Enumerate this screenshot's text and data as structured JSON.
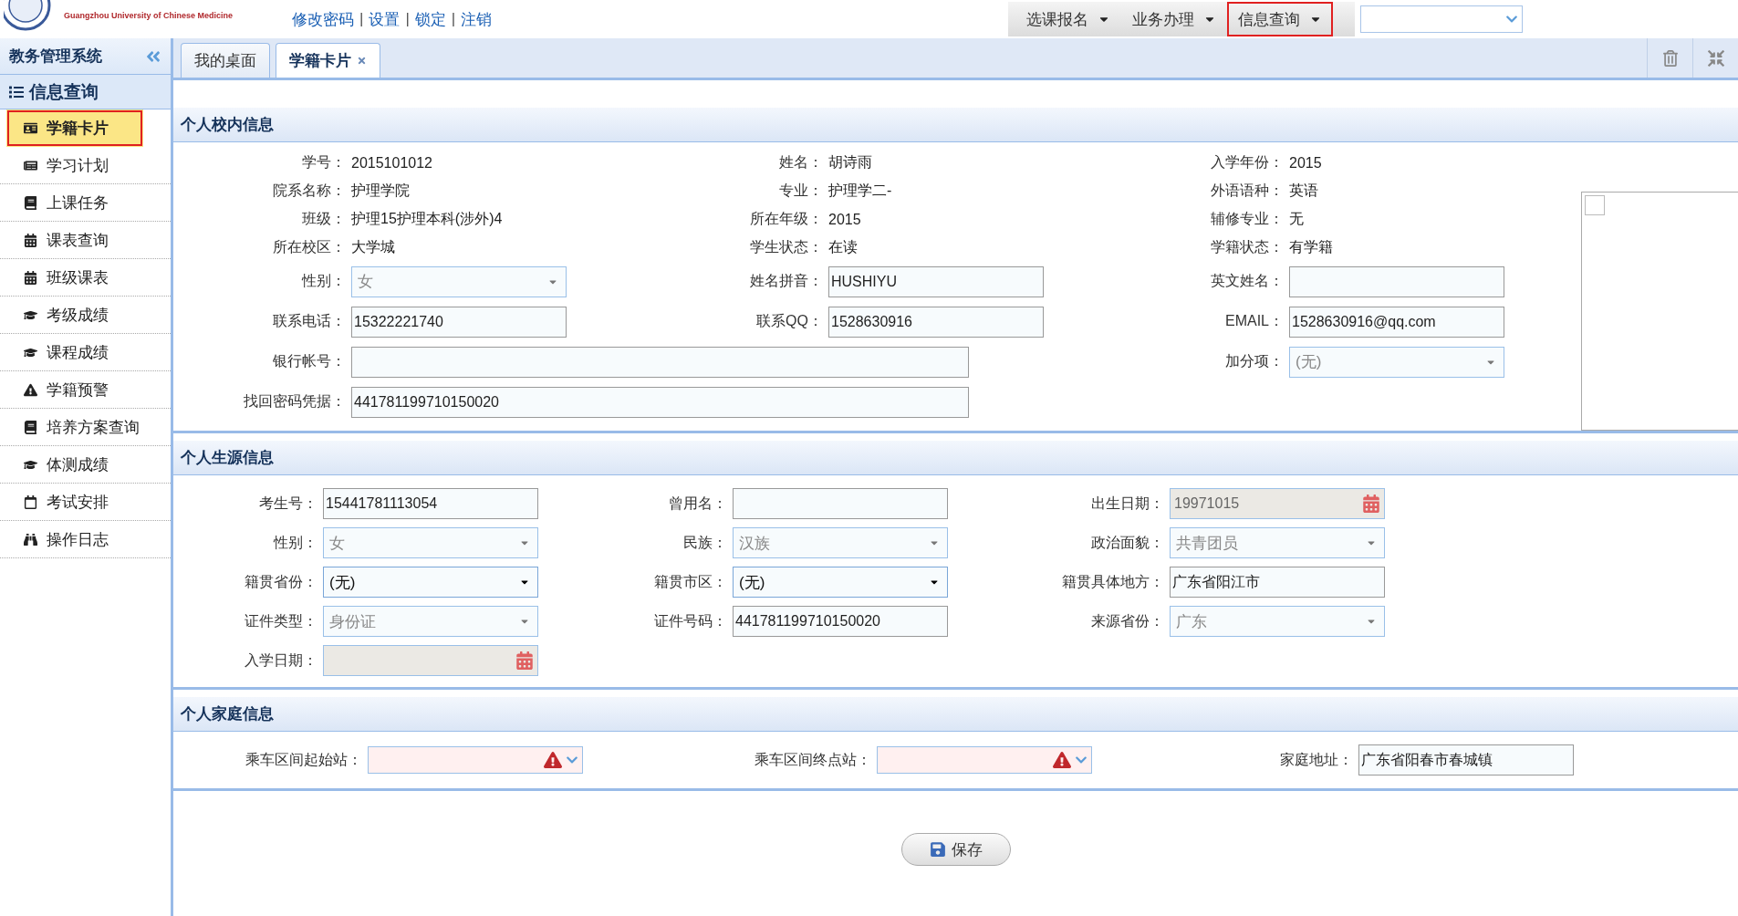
{
  "header": {
    "logo_subtitle": "Guangzhou University of Chinese Medicine",
    "links": [
      "修改密码",
      "设置",
      "锁定",
      "注销"
    ],
    "separator": "|",
    "menus": [
      {
        "label": "选课报名",
        "selected": false
      },
      {
        "label": "业务办理",
        "selected": false
      },
      {
        "label": "信息查询",
        "selected": true
      }
    ]
  },
  "sidebar": {
    "title": "教务管理系统",
    "group": "信息查询",
    "items": [
      {
        "label": "学籍卡片",
        "selected": true
      },
      {
        "label": "学习计划",
        "selected": false
      },
      {
        "label": "上课任务",
        "selected": false
      },
      {
        "label": "课表查询",
        "selected": false
      },
      {
        "label": "班级课表",
        "selected": false
      },
      {
        "label": "考级成绩",
        "selected": false
      },
      {
        "label": "课程成绩",
        "selected": false
      },
      {
        "label": "学籍预警",
        "selected": false
      },
      {
        "label": "培养方案查询",
        "selected": false
      },
      {
        "label": "体测成绩",
        "selected": false
      },
      {
        "label": "考试安排",
        "selected": false
      },
      {
        "label": "操作日志",
        "selected": false
      }
    ]
  },
  "tabs": [
    {
      "label": "我的桌面",
      "selected": false,
      "closable": false
    },
    {
      "label": "学籍卡片",
      "selected": true,
      "closable": true
    }
  ],
  "sections": [
    {
      "title": "个人校内信息",
      "fields": [
        {
          "label": "学号：",
          "kind": "text",
          "value": "2015101012"
        },
        {
          "label": "姓名：",
          "kind": "text",
          "value": "胡诗雨"
        },
        {
          "label": "入学年份：",
          "kind": "text",
          "value": "2015"
        },
        {
          "label": "院系名称：",
          "kind": "text",
          "value": "护理学院"
        },
        {
          "label": "专业：",
          "kind": "text",
          "value": "护理学二-"
        },
        {
          "label": "外语语种：",
          "kind": "text",
          "value": "英语"
        },
        {
          "label": "班级：",
          "kind": "text",
          "value": "护理15护理本科(涉外)4"
        },
        {
          "label": "所在年级：",
          "kind": "text",
          "value": "2015"
        },
        {
          "label": "辅修专业：",
          "kind": "text",
          "value": "无"
        },
        {
          "label": "所在校区：",
          "kind": "text",
          "value": "大学城"
        },
        {
          "label": "学生状态：",
          "kind": "text",
          "value": "在读"
        },
        {
          "label": "学籍状态：",
          "kind": "text",
          "value": "有学籍"
        },
        {
          "label": "性别：",
          "kind": "select",
          "value": "女",
          "disabled": true
        },
        {
          "label": "姓名拼音：",
          "kind": "input",
          "value": "HUSHIYU"
        },
        {
          "label": "英文姓名：",
          "kind": "input"
        },
        {
          "label": "联系电话：",
          "kind": "input",
          "value": "15322221740"
        },
        {
          "label": "联系QQ：",
          "kind": "input",
          "value": "1528630916"
        },
        {
          "label": "EMAIL：",
          "kind": "input",
          "value": "1528630916@qq.com"
        },
        {
          "label": "银行帐号：",
          "kind": "long-input"
        },
        {
          "label": "加分项：",
          "kind": "select",
          "value": "(无)",
          "disabled": true
        },
        {
          "label": "找回密码凭据：",
          "kind": "long-input",
          "value": "441781199710150020"
        }
      ]
    },
    {
      "title": "个人生源信息",
      "fields": [
        {
          "label": "考生号：",
          "kind": "input",
          "value": "15441781113054"
        },
        {
          "label": "曾用名：",
          "kind": "input"
        },
        {
          "label": "出生日期：",
          "kind": "date",
          "value": "19971015",
          "disabled": true
        },
        {
          "label": "性别：",
          "kind": "select",
          "value": "女",
          "disabled": true
        },
        {
          "label": "民族：",
          "kind": "select",
          "value": "汉族",
          "disabled": true
        },
        {
          "label": "政治面貌：",
          "kind": "select",
          "value": "共青团员",
          "disabled": true
        },
        {
          "label": "籍贯省份：",
          "kind": "select",
          "value": "(无)",
          "disabled": false
        },
        {
          "label": "籍贯市区：",
          "kind": "select",
          "value": "(无)",
          "disabled": false
        },
        {
          "label": "籍贯具体地方：",
          "kind": "input",
          "value": "广东省阳江市"
        },
        {
          "label": "证件类型：",
          "kind": "select",
          "value": "身份证",
          "disabled": true
        },
        {
          "label": "证件号码：",
          "kind": "input",
          "value": "441781199710150020"
        },
        {
          "label": "来源省份：",
          "kind": "select",
          "value": "广东",
          "disabled": true
        },
        {
          "label": "入学日期：",
          "kind": "date",
          "disabled": true
        }
      ]
    },
    {
      "title": "个人家庭信息",
      "fields": [
        {
          "label": "乘车区间起始站：",
          "kind": "combo",
          "invalid": true
        },
        {
          "label": "乘车区间终点站：",
          "kind": "combo",
          "invalid": true
        },
        {
          "label": "家庭地址：",
          "kind": "input",
          "value": "广东省阳春市春城镇"
        }
      ]
    }
  ],
  "photo": {
    "checked": false
  },
  "save_button": "保存"
}
